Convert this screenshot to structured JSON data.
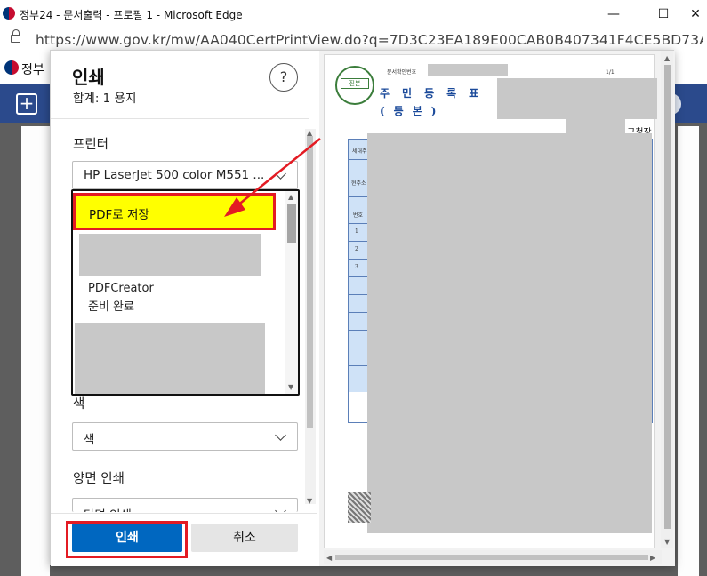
{
  "window": {
    "title": "정부24 - 문서출력 - 프로필 1 - Microsoft Edge",
    "minimize": "—",
    "maximize": "☐",
    "close": "✕"
  },
  "address_bar": {
    "url": "https://www.gov.kr/mw/AA040CertPrintView.do?q=7D3C23EA189E00CAB0B407341F4CE5BD73AB89A69..."
  },
  "background_page": {
    "logo_text": "정부"
  },
  "print_dialog": {
    "title": "인쇄",
    "sheet_count": "합계: 1 용지",
    "help": "?",
    "printer_label": "프린터",
    "printer_selected": "HP LaserJet 500 color M551 ...",
    "printer_options": [
      {
        "name": "PDF로 저장",
        "highlighted": true
      },
      {
        "name": "PDFCreator",
        "status": "준비 완료"
      }
    ],
    "color_label": "색",
    "color_value": "색",
    "duplex_label": "양면 인쇄",
    "duplex_value": "단면 인쇄",
    "print_button": "인쇄",
    "cancel_button": "취소"
  },
  "preview": {
    "seal_text": "진본",
    "doc_number_label": "문서확인번호",
    "page_indicator": "1/1",
    "doc_title": "주민등록표",
    "doc_subtitle": "(등본)",
    "issuer": "구청장",
    "row_numbers": [
      "1",
      "2",
      "3"
    ],
    "header_cells": [
      "세대주",
      "현주소",
      "번호"
    ]
  },
  "colors": {
    "highlight_fill": "#ffff00",
    "annotation_red": "#e31b23",
    "primary_button": "#0067c0"
  }
}
